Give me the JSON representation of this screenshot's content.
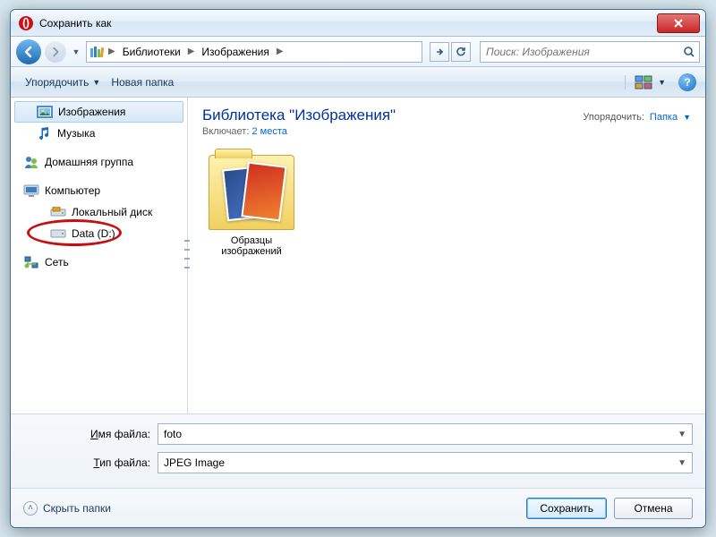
{
  "window": {
    "title": "Сохранить как"
  },
  "breadcrumb": {
    "items": [
      "Библиотеки",
      "Изображения"
    ]
  },
  "search": {
    "placeholder": "Поиск: Изображения"
  },
  "toolbar": {
    "organize": "Упорядочить",
    "new_folder": "Новая папка"
  },
  "sidebar": {
    "pictures": "Изображения",
    "music": "Музыка",
    "homegroup": "Домашняя группа",
    "computer": "Компьютер",
    "local_disk": "Локальный диск",
    "data_d": "Data (D:)",
    "network": "Сеть"
  },
  "library": {
    "title": "Библиотека \"Изображения\"",
    "includes_label": "Включает:",
    "includes_link": "2 места",
    "arrange_label": "Упорядочить:",
    "arrange_value": "Папка"
  },
  "items": {
    "sample_pictures_l1": "Образцы",
    "sample_pictures_l2": "изображений"
  },
  "fields": {
    "filename_label_u": "И",
    "filename_label_rest": "мя файла:",
    "filetype_label_u": "Т",
    "filetype_label_rest": "ип файла:",
    "filename_value": "foto",
    "filetype_value": "JPEG Image"
  },
  "footer": {
    "hide": "Скрыть папки",
    "save": "Сохранить",
    "cancel": "Отмена"
  }
}
